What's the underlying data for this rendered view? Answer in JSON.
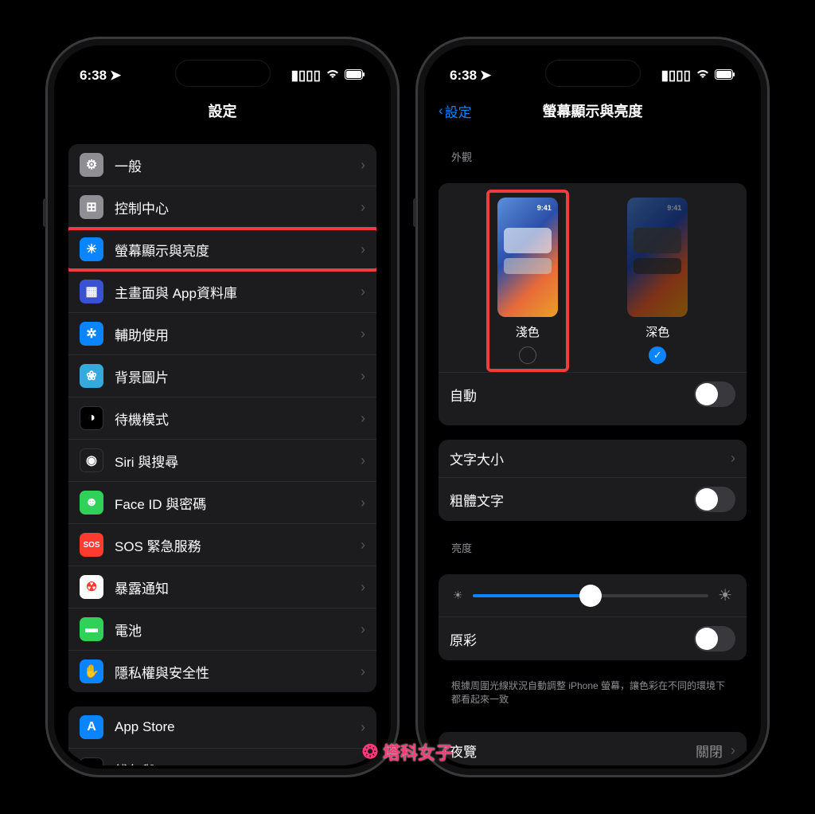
{
  "status": {
    "time": "6:38",
    "location_icon": "➤",
    "signal": "▮▮▮▮",
    "wifi": "📶",
    "battery_icon": "▢"
  },
  "left": {
    "title": "設定",
    "groups": [
      [
        {
          "icon": "⚙",
          "bg": "#8e8e93",
          "label": "一般"
        },
        {
          "icon": "⊞",
          "bg": "#8e8e93",
          "label": "控制中心"
        },
        {
          "icon": "☀",
          "bg": "#0a84ff",
          "label": "螢幕顯示與亮度",
          "highlight": true
        },
        {
          "icon": "▦",
          "bg": "#3952d4",
          "label": "主畫面與 App資料庫"
        },
        {
          "icon": "✲",
          "bg": "#0a84ff",
          "label": "輔助使用"
        },
        {
          "icon": "❀",
          "bg": "#34aadc",
          "label": "背景圖片"
        },
        {
          "icon": "◑",
          "bg": "#000",
          "label": "待機模式"
        },
        {
          "icon": "◉",
          "bg": "#1c1c1e",
          "label": "Siri 與搜尋"
        },
        {
          "icon": "☻",
          "bg": "#30d158",
          "label": "Face ID 與密碼"
        },
        {
          "icon_text": "SOS",
          "bg": "#ff3b30",
          "label": "SOS 緊急服務"
        },
        {
          "icon": "☢",
          "bg": "#fff",
          "fg": "#ff3b30",
          "label": "暴露通知"
        },
        {
          "icon": "▬",
          "bg": "#30d158",
          "label": "電池"
        },
        {
          "icon": "✋",
          "bg": "#0a84ff",
          "label": "隱私權與安全性"
        }
      ],
      [
        {
          "icon": "A",
          "bg": "#0a84ff",
          "label": "App Store"
        },
        {
          "icon": "▭",
          "bg": "#000",
          "label": "錢包與 Apple Pay"
        }
      ]
    ]
  },
  "right": {
    "back": "設定",
    "title": "螢幕顯示與亮度",
    "appearance_header": "外觀",
    "theme_time": "9:41",
    "light_label": "淺色",
    "dark_label": "深色",
    "auto_label": "自動",
    "text_size_label": "文字大小",
    "bold_text_label": "粗體文字",
    "brightness_header": "亮度",
    "brightness_value": 50,
    "true_tone_label": "原彩",
    "true_tone_note": "根據周圍光線狀況自動調整 iPhone 螢幕，讓色彩在不同的環境下都看起來一致",
    "night_shift_label": "夜覽",
    "night_shift_value": "關閉"
  },
  "watermark": {
    "text": "塔科女子"
  }
}
